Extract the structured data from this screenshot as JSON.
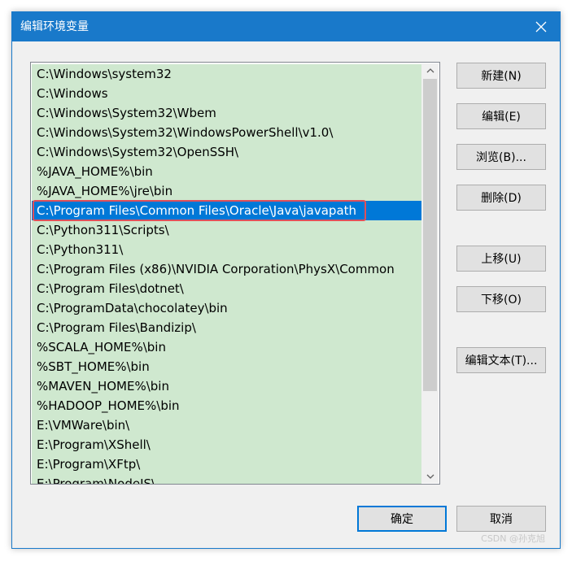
{
  "window": {
    "title": "编辑环境变量"
  },
  "icons": {
    "close": "close-icon",
    "scroll_up": "chevron-up-icon",
    "scroll_down": "chevron-down-icon"
  },
  "colors": {
    "titlebar": "#1979ca",
    "item_background": "#cfe8cf",
    "selection": "#0078d7",
    "highlight_border": "#e0505a"
  },
  "path_list": {
    "selected_index": 7,
    "items": [
      "C:\\Windows\\system32",
      "C:\\Windows",
      "C:\\Windows\\System32\\Wbem",
      "C:\\Windows\\System32\\WindowsPowerShell\\v1.0\\",
      "C:\\Windows\\System32\\OpenSSH\\",
      "%JAVA_HOME%\\bin",
      "%JAVA_HOME%\\jre\\bin",
      "C:\\Program Files\\Common Files\\Oracle\\Java\\javapath",
      "C:\\Python311\\Scripts\\",
      "C:\\Python311\\",
      "C:\\Program Files (x86)\\NVIDIA Corporation\\PhysX\\Common",
      "C:\\Program Files\\dotnet\\",
      "C:\\ProgramData\\chocolatey\\bin",
      "C:\\Program Files\\Bandizip\\",
      "%SCALA_HOME%\\bin",
      "%SBT_HOME%\\bin",
      "%MAVEN_HOME%\\bin",
      "%HADOOP_HOME%\\bin",
      "E:\\VMWare\\bin\\",
      "E:\\Program\\XShell\\",
      "E:\\Program\\XFtp\\",
      "E:\\Program\\NodeJS\\"
    ]
  },
  "buttons": {
    "new": "新建(N)",
    "edit": "编辑(E)",
    "browse": "浏览(B)...",
    "delete": "删除(D)",
    "move_up": "上移(U)",
    "move_down": "下移(O)",
    "edit_text": "编辑文本(T)...",
    "ok": "确定",
    "cancel": "取消"
  },
  "watermark": "CSDN @孙克旭"
}
